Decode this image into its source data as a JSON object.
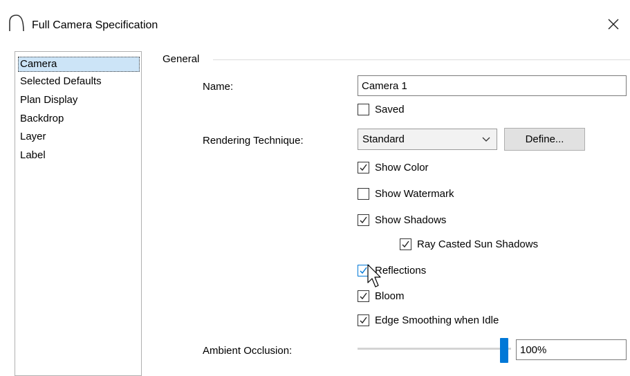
{
  "window": {
    "title": "Full Camera Specification",
    "close_icon": "close-icon"
  },
  "nav": {
    "items": [
      {
        "label": "Camera",
        "selected": true
      },
      {
        "label": "Selected Defaults"
      },
      {
        "label": "Plan Display"
      },
      {
        "label": "Backdrop"
      },
      {
        "label": "Layer"
      },
      {
        "label": "Label"
      }
    ]
  },
  "general": {
    "group_label": "General",
    "name_label": "Name:",
    "name_value": "Camera 1",
    "saved": {
      "label": "Saved",
      "checked": false
    },
    "rendering_label": "Rendering Technique:",
    "rendering_value": "Standard",
    "define_button": "Define...",
    "checkboxes": {
      "show_color": {
        "label": "Show Color",
        "checked": true
      },
      "show_watermark": {
        "label": "Show Watermark",
        "checked": false
      },
      "show_shadows": {
        "label": "Show Shadows",
        "checked": true
      },
      "ray_casted": {
        "label": "Ray Casted Sun Shadows",
        "checked": true
      },
      "reflections": {
        "label": "Reflections",
        "checked": true
      },
      "bloom": {
        "label": "Bloom",
        "checked": true
      },
      "edge_smoothing": {
        "label": "Edge Smoothing when Idle",
        "checked": true
      }
    },
    "ambient_label": "Ambient Occlusion:",
    "ambient_value": "100%",
    "ambient_level": 1.0
  },
  "colors": {
    "accent": "#0078d7",
    "selection": "#cce4f7"
  }
}
